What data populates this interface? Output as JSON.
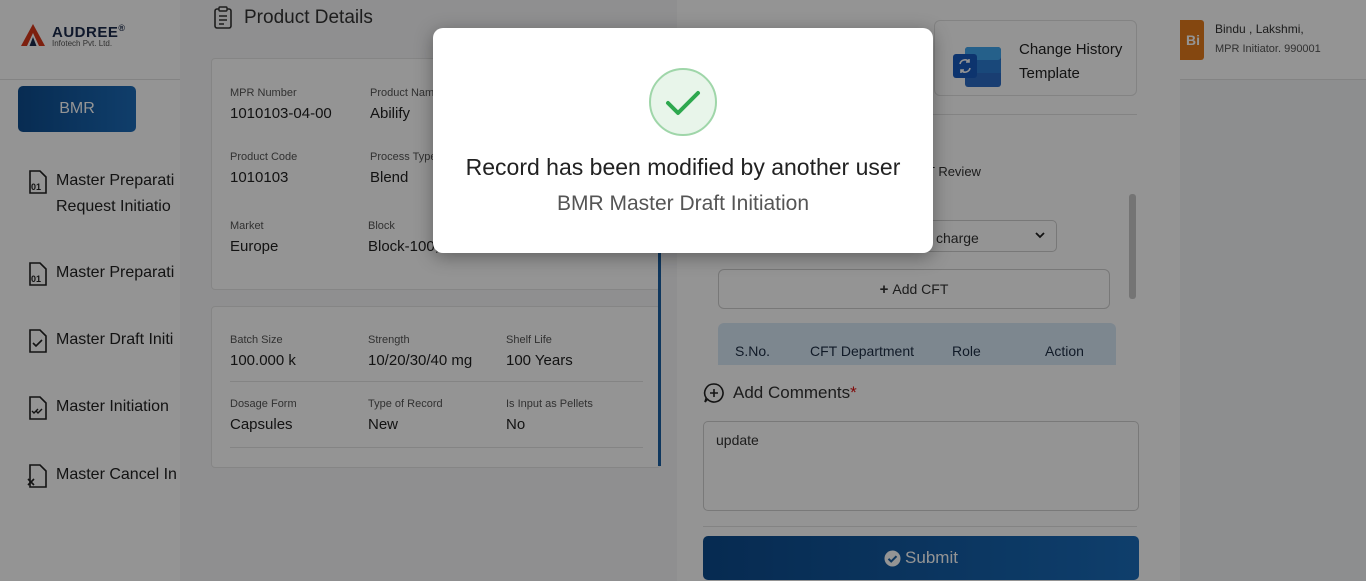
{
  "brand": {
    "name": "AUDREE",
    "trademark": "®",
    "subtitle": "Infotech Pvt. Ltd."
  },
  "user": {
    "avatar_initials": "Bi",
    "name": "Bindu , Lakshmi,",
    "role": "MPR Initiator. 990001"
  },
  "sidebar": {
    "module_button": "BMR",
    "items": [
      {
        "label": "Master Preparati",
        "label2": "Request Initiatio",
        "icon": "document-01-icon"
      },
      {
        "label": "Master Preparati",
        "icon": "document-01-icon"
      },
      {
        "label": "Master Draft Initi",
        "icon": "document-check-icon"
      },
      {
        "label": "Master Initiation",
        "icon": "document-checks-icon"
      },
      {
        "label": "Master Cancel In",
        "icon": "document-cancel-icon"
      }
    ]
  },
  "product_details": {
    "title": "Product Details",
    "card1": [
      {
        "label": "MPR Number",
        "value": "1010103-04-00"
      },
      {
        "label": "Product Nam",
        "value": "Abilify"
      },
      {
        "label": "Product Code",
        "value": "1010103"
      },
      {
        "label": "Process Type",
        "value": "Blend"
      },
      {
        "label": "Market",
        "value": "Europe"
      },
      {
        "label": "Block",
        "value": "Block-100,"
      }
    ],
    "card2": [
      {
        "label": "Batch Size",
        "value": "100.000 k"
      },
      {
        "label": "Strength",
        "value": "10/20/30/40 mg"
      },
      {
        "label": "Shelf Life",
        "value": "100 Years"
      },
      {
        "label": "Dosage Form",
        "value": "Capsules"
      },
      {
        "label": "Type of Record",
        "value": "New"
      },
      {
        "label": "Is Input as Pellets",
        "value": "No"
      }
    ]
  },
  "right_panel": {
    "template_card": {
      "line1": "Change History",
      "line2": "Template"
    },
    "cft_review_label": "T Review",
    "select_value": "charge",
    "add_cft_label": "Add CFT",
    "table_headers": [
      "S.No.",
      "CFT Department",
      "Role",
      "Action"
    ],
    "comments_title": "Add Comments",
    "comments_required": "*",
    "comment_text": "update",
    "submit_label": "Submit"
  },
  "modal": {
    "title": "Record has been modified by another user",
    "subtitle": "BMR Master Draft Initiation",
    "icon": "success-check-icon",
    "accent_color": "#2ea84f"
  }
}
